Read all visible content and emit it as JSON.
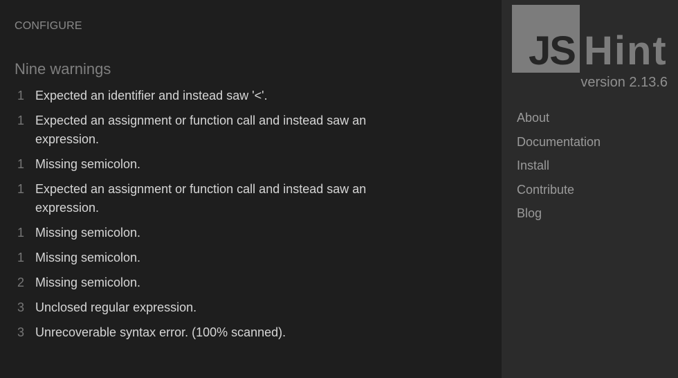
{
  "main": {
    "configure_label": "CONFIGURE",
    "warnings_title": "Nine warnings",
    "warnings": [
      {
        "line": "1",
        "message": "Expected an identifier and instead saw '<'."
      },
      {
        "line": "1",
        "message": "Expected an assignment or function call and instead saw an expression."
      },
      {
        "line": "1",
        "message": "Missing semicolon."
      },
      {
        "line": "1",
        "message": "Expected an assignment or function call and instead saw an expression."
      },
      {
        "line": "1",
        "message": "Missing semicolon."
      },
      {
        "line": "1",
        "message": "Missing semicolon."
      },
      {
        "line": "2",
        "message": "Missing semicolon."
      },
      {
        "line": "3",
        "message": "Unclosed regular expression."
      },
      {
        "line": "3",
        "message": "Unrecoverable syntax error. (100% scanned)."
      }
    ]
  },
  "sidebar": {
    "logo_js": "JS",
    "logo_hint": "Hint",
    "version": "version 2.13.6",
    "nav": [
      "About",
      "Documentation",
      "Install",
      "Contribute",
      "Blog"
    ]
  },
  "colors": {
    "main_bg": "#1e1e1e",
    "sidebar_bg": "#2b2b2b",
    "logo_gray": "#7c7c7c",
    "text_light": "#d6d6d6"
  }
}
